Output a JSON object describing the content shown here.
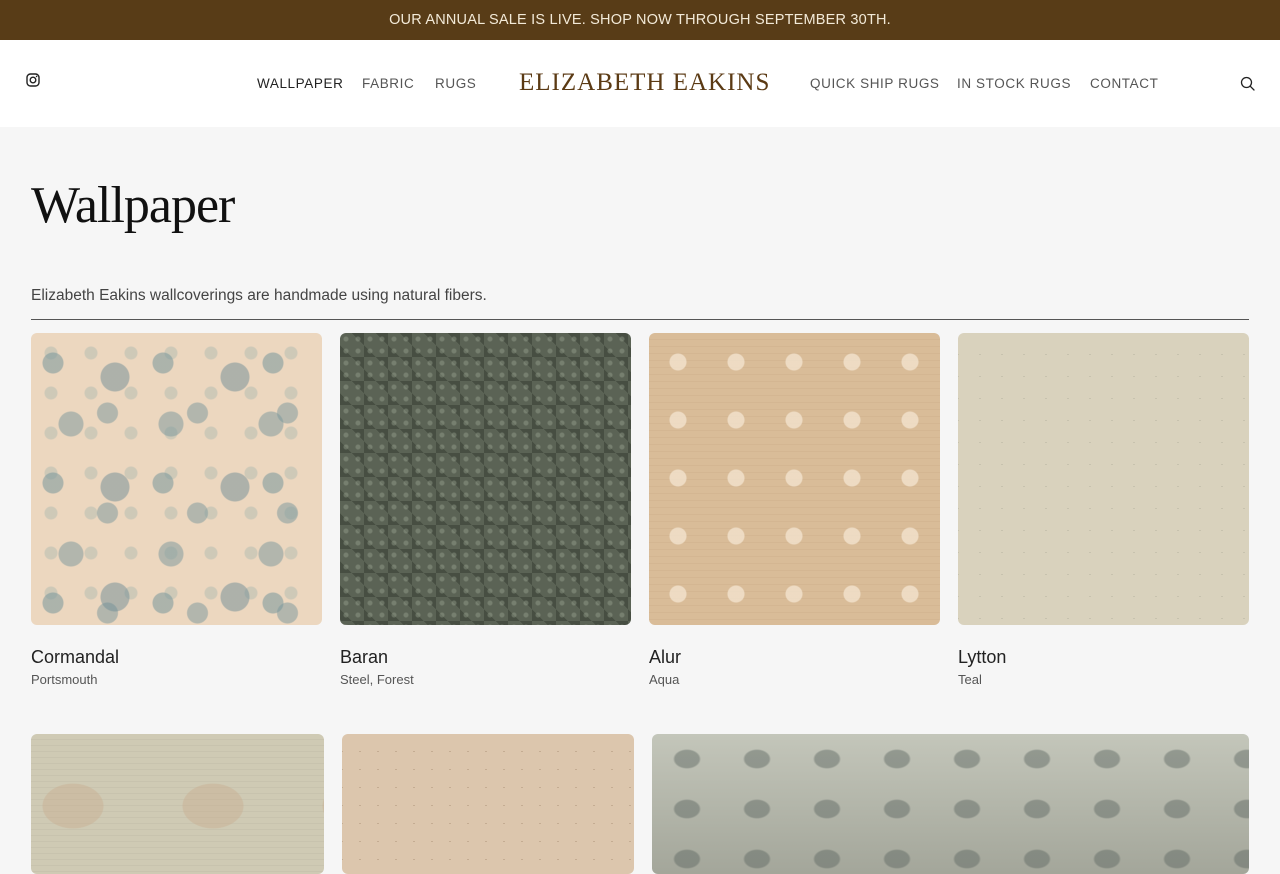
{
  "announcement": "OUR ANNUAL SALE IS LIVE. SHOP NOW THROUGH SEPTEMBER 30TH.",
  "header": {
    "logo": "ELIZABETH EAKINS",
    "nav_left": [
      "WALLPAPER",
      "FABRIC",
      "RUGS"
    ],
    "nav_right": [
      "QUICK SHIP RUGS",
      "IN STOCK RUGS",
      "CONTACT"
    ],
    "icons": [
      "instagram-icon",
      "search-icon"
    ]
  },
  "page": {
    "title": "Wallpaper",
    "intro": "Elizabeth Eakins wallcoverings are handmade using natural fibers."
  },
  "products": [
    {
      "name": "Cormandal",
      "color": "Portsmouth"
    },
    {
      "name": "Baran",
      "color": "Steel, Forest"
    },
    {
      "name": "Alur",
      "color": "Aqua"
    },
    {
      "name": "Lytton",
      "color": "Teal"
    }
  ],
  "colors": {
    "announcement_bg": "#583c17",
    "logo": "#5b3a14",
    "page_bg": "#f6f6f6"
  }
}
